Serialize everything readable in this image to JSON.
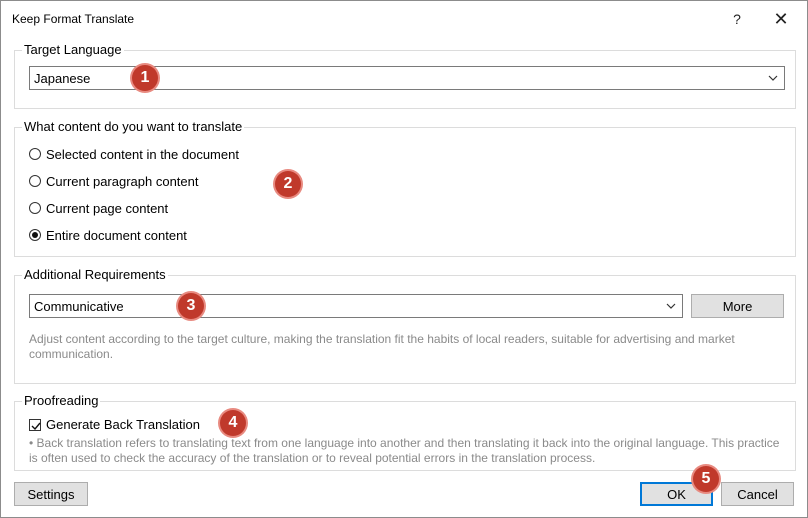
{
  "window": {
    "title": "Keep Format Translate",
    "help_label": "?",
    "close_label": "✕"
  },
  "target_language": {
    "label": "Target Language",
    "value": "Japanese"
  },
  "content": {
    "label": "What content do you want to translate",
    "options": [
      {
        "label": "Selected content in the document",
        "checked": false
      },
      {
        "label": "Current paragraph content",
        "checked": false
      },
      {
        "label": "Current page content",
        "checked": false
      },
      {
        "label": "Entire document content",
        "checked": true
      }
    ]
  },
  "additional": {
    "label": "Additional Requirements",
    "value": "Communicative",
    "more_label": "More",
    "description": "Adjust content according to the target culture, making the translation fit the habits of local readers, suitable for advertising and market communication."
  },
  "proofreading": {
    "label": "Proofreading",
    "checkbox_label": "Generate Back Translation",
    "checked": true,
    "description": "• Back translation refers to translating text from one language into another and then translating it back into the original language. This practice is often used to check the accuracy of the translation or to reveal potential errors in the translation process."
  },
  "footer": {
    "settings_label": "Settings",
    "ok_label": "OK",
    "cancel_label": "Cancel"
  },
  "badges": [
    "1",
    "2",
    "3",
    "4",
    "5"
  ],
  "colors": {
    "badge": "#c0392b",
    "default_button_border": "#0078d7"
  }
}
